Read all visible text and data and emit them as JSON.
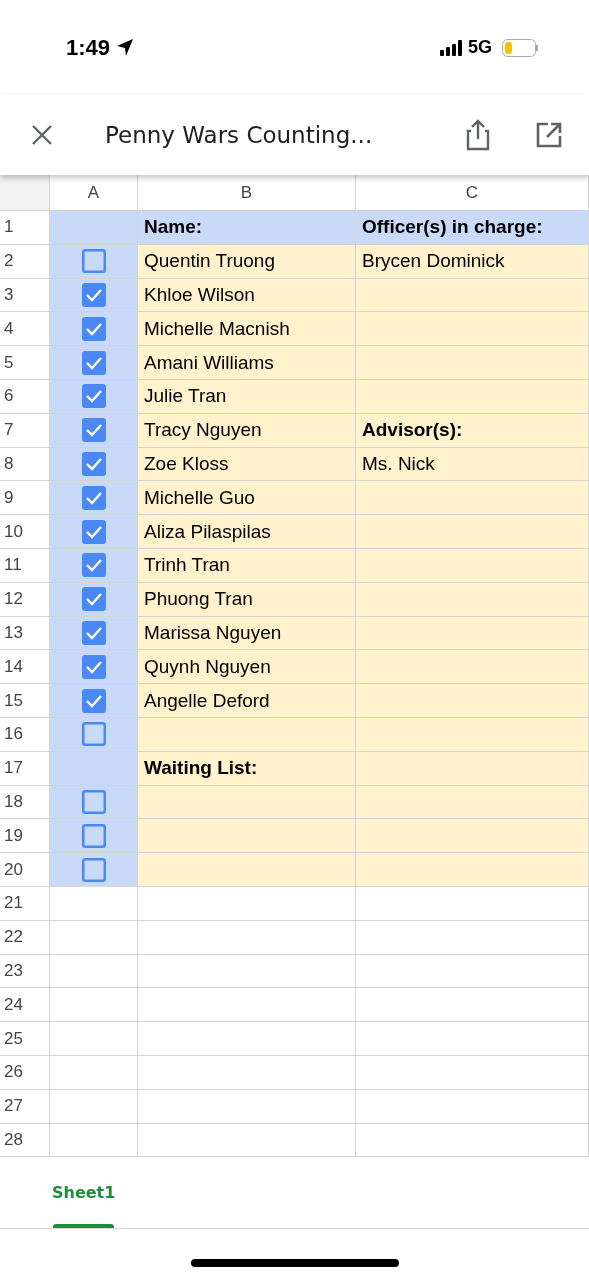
{
  "status_bar": {
    "time": "1:49",
    "network": "5G"
  },
  "toolbar": {
    "title": "Penny Wars Counting..."
  },
  "table": {
    "columns": [
      "A",
      "B",
      "C"
    ],
    "rows": [
      {
        "number": "1",
        "kind": "header",
        "b": {
          "text": "Name:",
          "bold": true
        },
        "c": {
          "text": "Officer(s) in charge:",
          "bold": true
        }
      },
      {
        "number": "2",
        "kind": "list",
        "checked": false,
        "b": {
          "text": "Quentin Truong",
          "bold": false
        },
        "c": {
          "text": "Brycen Dominick",
          "bold": false
        }
      },
      {
        "number": "3",
        "kind": "list",
        "checked": true,
        "b": {
          "text": "Khloe Wilson",
          "bold": false
        }
      },
      {
        "number": "4",
        "kind": "list",
        "checked": true,
        "b": {
          "text": "Michelle Macnish",
          "bold": false
        }
      },
      {
        "number": "5",
        "kind": "list",
        "checked": true,
        "b": {
          "text": "Amani Williams",
          "bold": false
        }
      },
      {
        "number": "6",
        "kind": "list",
        "checked": true,
        "b": {
          "text": "Julie Tran",
          "bold": false
        }
      },
      {
        "number": "7",
        "kind": "list",
        "checked": true,
        "b": {
          "text": "Tracy Nguyen",
          "bold": false
        },
        "c": {
          "text": "Advisor(s):",
          "bold": true
        }
      },
      {
        "number": "8",
        "kind": "list",
        "checked": true,
        "b": {
          "text": "Zoe Kloss",
          "bold": false
        },
        "c": {
          "text": "Ms. Nick",
          "bold": false
        }
      },
      {
        "number": "9",
        "kind": "list",
        "checked": true,
        "b": {
          "text": "Michelle Guo",
          "bold": false
        }
      },
      {
        "number": "10",
        "kind": "list",
        "checked": true,
        "b": {
          "text": "Aliza Pilaspilas",
          "bold": false
        }
      },
      {
        "number": "11",
        "kind": "list",
        "checked": true,
        "b": {
          "text": "Trinh Tran",
          "bold": false
        }
      },
      {
        "number": "12",
        "kind": "list",
        "checked": true,
        "b": {
          "text": "Phuong Tran",
          "bold": false
        }
      },
      {
        "number": "13",
        "kind": "list",
        "checked": true,
        "b": {
          "text": "Marissa Nguyen",
          "bold": false
        }
      },
      {
        "number": "14",
        "kind": "list",
        "checked": true,
        "b": {
          "text": "Quynh Nguyen",
          "bold": false
        }
      },
      {
        "number": "15",
        "kind": "list",
        "checked": true,
        "b": {
          "text": "Angelle Deford",
          "bold": false
        }
      },
      {
        "number": "16",
        "kind": "list",
        "checked": false
      },
      {
        "number": "17",
        "kind": "list",
        "b": {
          "text": "Waiting List:",
          "bold": true
        }
      },
      {
        "number": "18",
        "kind": "list",
        "checked": false
      },
      {
        "number": "19",
        "kind": "list",
        "checked": false
      },
      {
        "number": "20",
        "kind": "list",
        "checked": false
      },
      {
        "number": "21",
        "kind": "blank"
      },
      {
        "number": "22",
        "kind": "blank"
      },
      {
        "number": "23",
        "kind": "blank"
      },
      {
        "number": "24",
        "kind": "blank"
      },
      {
        "number": "25",
        "kind": "blank"
      },
      {
        "number": "26",
        "kind": "blank"
      },
      {
        "number": "27",
        "kind": "blank"
      },
      {
        "number": "28",
        "kind": "blank"
      }
    ]
  },
  "sheet_tabs": [
    {
      "label": "Sheet1",
      "selected": true
    }
  ]
}
